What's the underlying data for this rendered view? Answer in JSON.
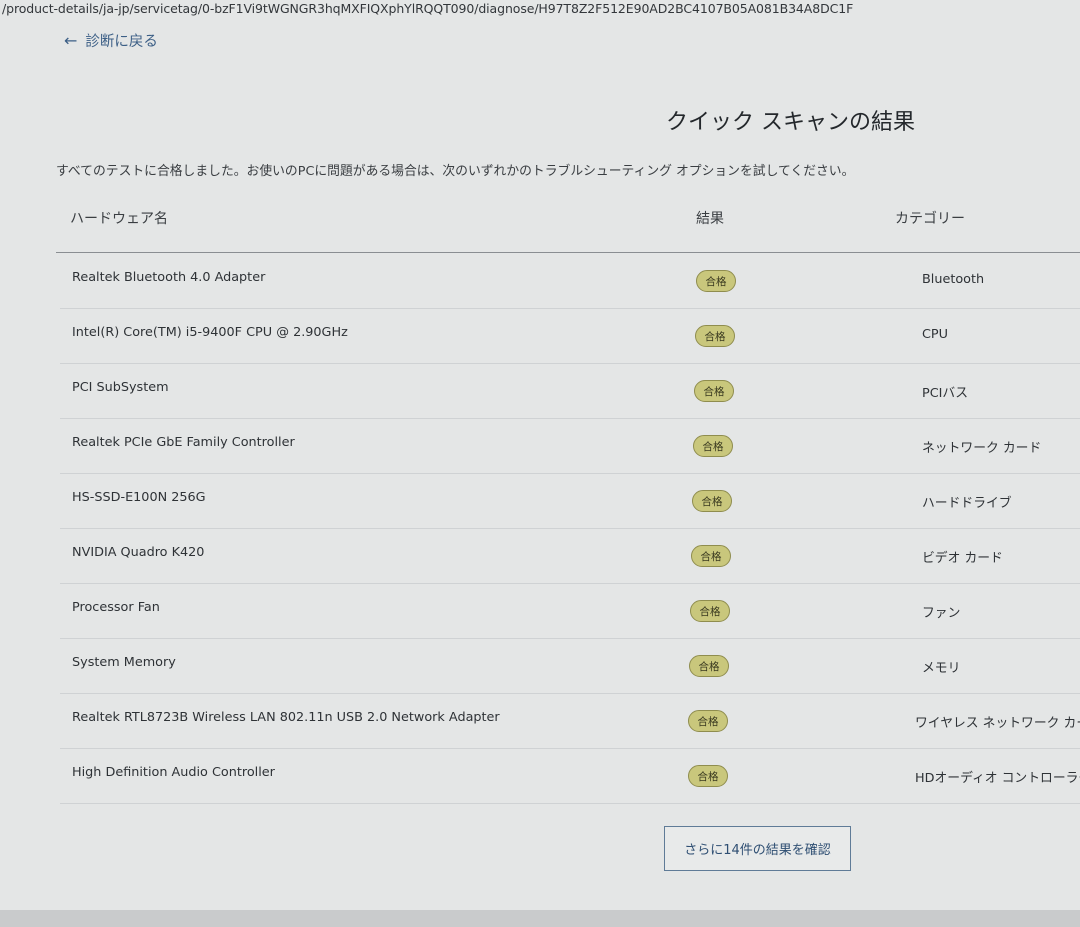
{
  "browser": {
    "url": "/product-details/ja-jp/servicetag/0-bzF1Vi9tWGNGR3hqMXFIQXphYlRQQT090/diagnose/H97T8Z2F512E90AD2BC4107B05A081B34A8DC1F"
  },
  "nav": {
    "back_label": "診断に戻る",
    "back_icon": "left-arrow-icon"
  },
  "page": {
    "title": "クイック スキャンの結果",
    "summary": "すべてのテストに合格しました。お使いのPCに問題がある場合は、次のいずれかのトラブルシューティング オプションを試してください。"
  },
  "table": {
    "headers": {
      "name": "ハードウェア名",
      "result": "結果",
      "category": "カテゴリー"
    },
    "rows": [
      {
        "name": "Realtek Bluetooth 4.0 Adapter",
        "result": "合格",
        "category": "Bluetooth"
      },
      {
        "name": "Intel(R) Core(TM) i5-9400F CPU @ 2.90GHz",
        "result": "合格",
        "category": "CPU"
      },
      {
        "name": "PCI SubSystem",
        "result": "合格",
        "category": "PCIバス"
      },
      {
        "name": "Realtek PCIe GbE Family Controller",
        "result": "合格",
        "category": "ネットワーク カード"
      },
      {
        "name": "HS-SSD-E100N 256G",
        "result": "合格",
        "category": "ハードドライブ"
      },
      {
        "name": "NVIDIA Quadro K420",
        "result": "合格",
        "category": "ビデオ カード"
      },
      {
        "name": "Processor Fan",
        "result": "合格",
        "category": "ファン"
      },
      {
        "name": "System Memory",
        "result": "合格",
        "category": "メモリ"
      },
      {
        "name": "Realtek RTL8723B Wireless LAN 802.11n USB 2.0 Network Adapter",
        "result": "合格",
        "category": "ワイヤレス ネットワーク カード"
      },
      {
        "name": "High Definition Audio Controller",
        "result": "合格",
        "category": "HDオーディオ コントローラー"
      }
    ]
  },
  "more_button": {
    "label": "さらに14件の結果を確認"
  },
  "colors": {
    "background": "#e4e6e6",
    "badge": "#c9c77c",
    "link": "#3c5f86"
  }
}
